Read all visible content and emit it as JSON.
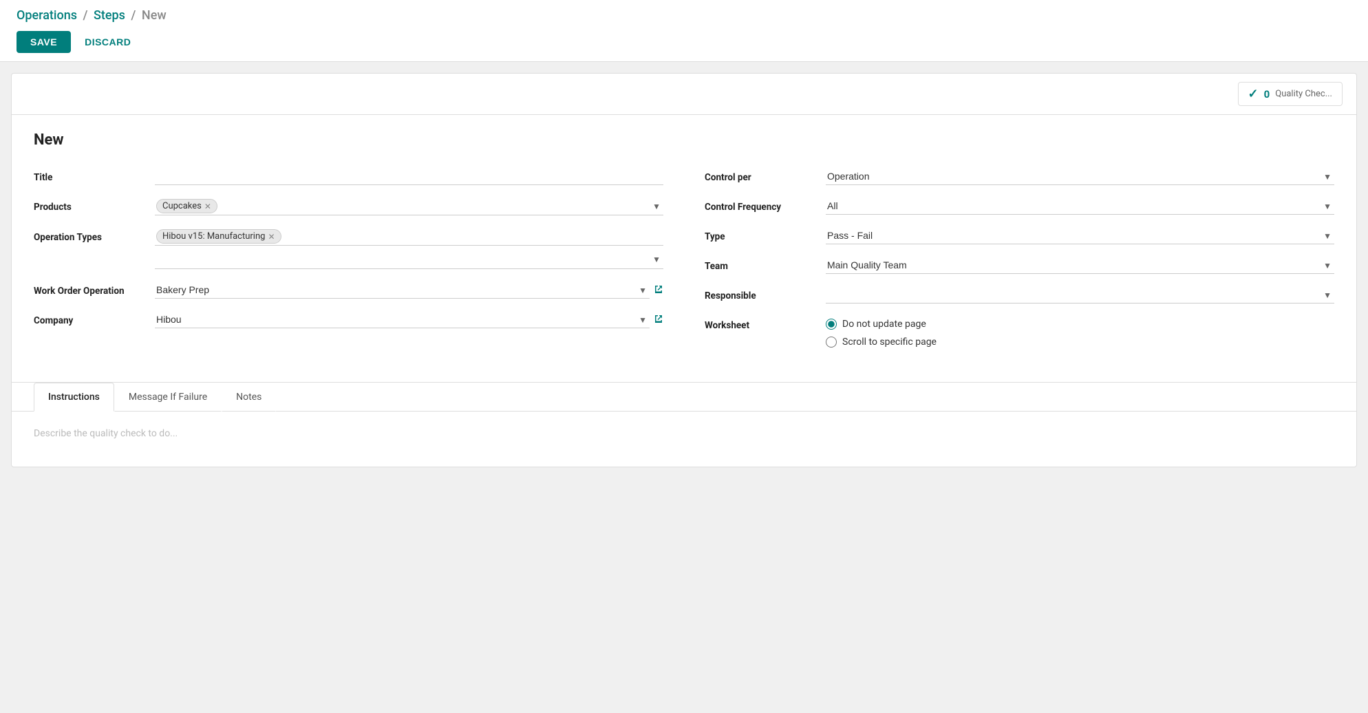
{
  "breadcrumb": {
    "part1": "Operations",
    "separator1": "/",
    "part2": "Steps",
    "separator2": "/",
    "current": "New"
  },
  "actions": {
    "save_label": "SAVE",
    "discard_label": "DISCARD"
  },
  "quality_check": {
    "count": "0",
    "label": "Quality Chec..."
  },
  "form": {
    "record_title": "New",
    "title_label": "Title",
    "title_value": "",
    "products_label": "Products",
    "products_tag": "Cupcakes",
    "operation_types_label": "Operation Types",
    "operation_types_tag": "Hibou v15: Manufacturing",
    "operation_types_extra": "",
    "work_order_label": "Work Order Operation",
    "work_order_value": "Bakery Prep",
    "company_label": "Company",
    "company_value": "Hibou",
    "control_per_label": "Control per",
    "control_per_value": "Operation",
    "control_frequency_label": "Control Frequency",
    "control_frequency_value": "All",
    "type_label": "Type",
    "type_value": "Pass - Fail",
    "team_label": "Team",
    "team_value": "Main Quality Team",
    "responsible_label": "Responsible",
    "responsible_value": "",
    "worksheet_label": "Worksheet",
    "worksheet_option1": "Do not update page",
    "worksheet_option2": "Scroll to specific page"
  },
  "tabs": {
    "instructions_label": "Instructions",
    "message_if_failure_label": "Message If Failure",
    "notes_label": "Notes",
    "active_tab": "Instructions",
    "instructions_placeholder": "Describe the quality check to do..."
  }
}
